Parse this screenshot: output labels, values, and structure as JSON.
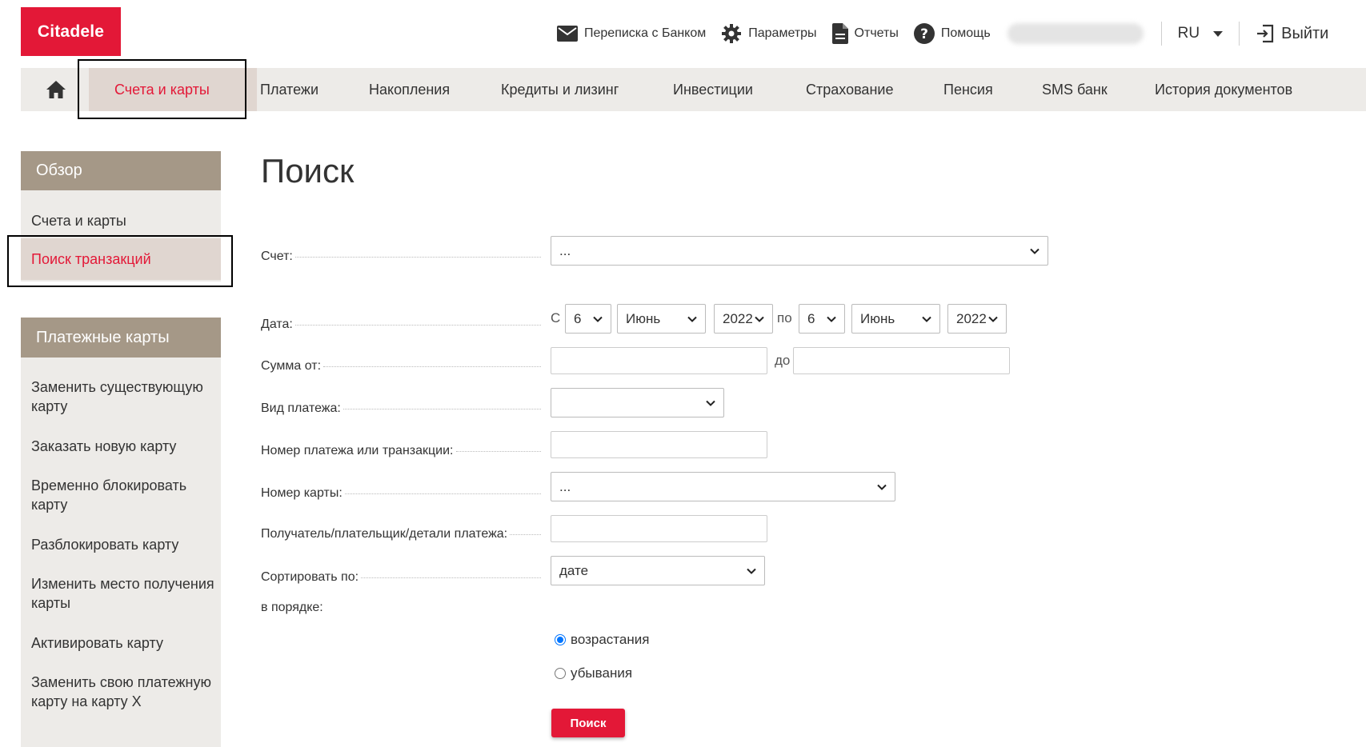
{
  "header": {
    "logo_text": "Citadele",
    "links": {
      "messages": "Переписка с Банком",
      "settings": "Параметры",
      "reports": "Отчеты",
      "help": "Помощь"
    },
    "language": "RU",
    "logout": "Выйти"
  },
  "nav": {
    "items": [
      "Счета и карты",
      "Платежи",
      "Накопления",
      "Кредиты и лизинг",
      "Инвестиции",
      "Страхование",
      "Пенсия",
      "SMS банк",
      "История документов"
    ],
    "active": "Счета и карты"
  },
  "sidebar": {
    "overview_title": "Обзор",
    "overview_items": [
      "Счета и карты",
      "Поиск транзакций"
    ],
    "cards_title": "Платежные карты",
    "cards_items": [
      "Заменить существующую карту",
      "Заказать новую карту",
      "Временно блокировать карту",
      "Разблокировать карту",
      "Изменить место получения карты",
      "Активировать карту",
      "Заменить свою платежную карту на карту X"
    ]
  },
  "main": {
    "title": "Поиск",
    "account_label": "Счет:",
    "account_value": "...",
    "date_label": "Дата:",
    "date_from_prefix": "С",
    "date_from": {
      "day": "6",
      "month": "Июнь",
      "year": "2022"
    },
    "date_to_prefix": "по",
    "date_to": {
      "day": "6",
      "month": "Июнь",
      "year": "2022"
    },
    "amount_label": "Сумма от:",
    "amount_to_label": "до",
    "amount_from_value": "",
    "amount_to_value": "",
    "payment_type_label": "Вид платежа:",
    "payment_type_value": "",
    "payment_number_label": "Номер платежа или транзакции:",
    "payment_number_value": "",
    "card_number_label": "Номер карты:",
    "card_number_value": "...",
    "counterparty_label": "Получатель/плательщик/детали платежа:",
    "counterparty_value": "",
    "sort_label": "Сортировать по:",
    "sort_value": "дате",
    "order_label": "в порядке:",
    "order_asc": "возрастания",
    "order_desc": "убывания",
    "order_selected": "asc",
    "search_button": "Поиск"
  },
  "colors": {
    "brand_red": "#e31837",
    "nav_bg": "#edebe8",
    "active_bg": "#e0d6d0",
    "sidebar_header": "#a59887"
  }
}
